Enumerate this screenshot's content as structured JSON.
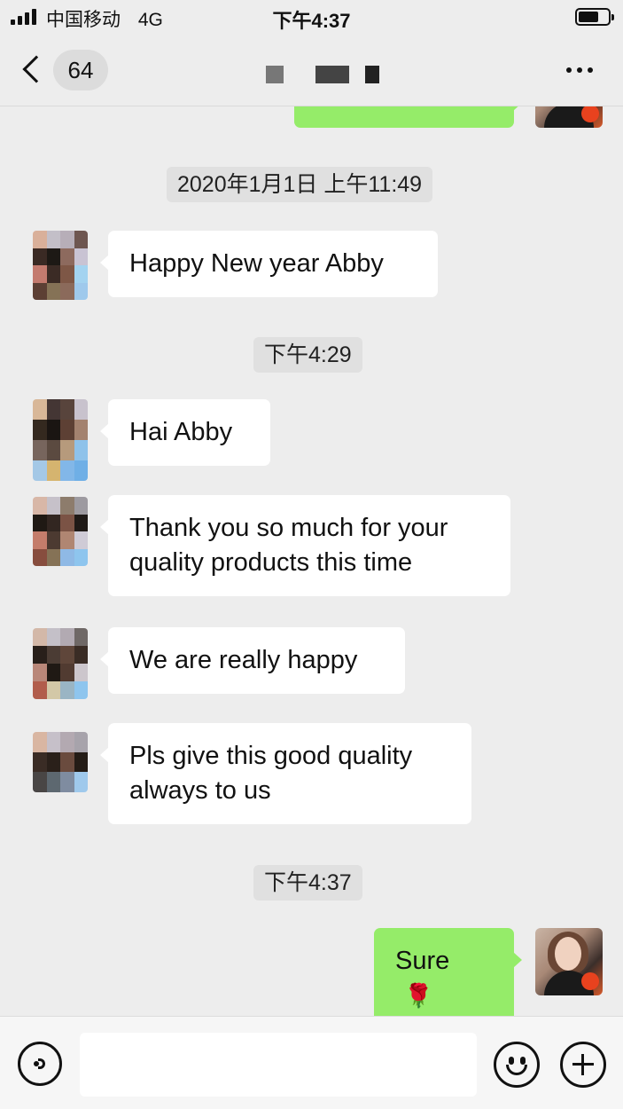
{
  "status_bar": {
    "carrier": "中国移动",
    "network": "4G",
    "time": "下午4:37"
  },
  "nav": {
    "unread_count": "64"
  },
  "messages": [
    {
      "type": "time",
      "text": "2020年1月1日 上午11:49"
    },
    {
      "type": "in",
      "text": "Happy New year Abby"
    },
    {
      "type": "time",
      "text": "下午4:29"
    },
    {
      "type": "in",
      "text": "Hai Abby"
    },
    {
      "type": "in",
      "text": "Thank you so much for your quality products this time"
    },
    {
      "type": "in",
      "text": "We are really happy"
    },
    {
      "type": "in",
      "text": "Pls give this good quality always to us"
    },
    {
      "type": "time",
      "text": "下午4:37"
    },
    {
      "type": "out",
      "text": "Sure",
      "emoji": "🌹"
    }
  ],
  "colors": {
    "background": "#ededed",
    "outgoing_bubble": "#95ec69",
    "incoming_bubble": "#ffffff"
  }
}
